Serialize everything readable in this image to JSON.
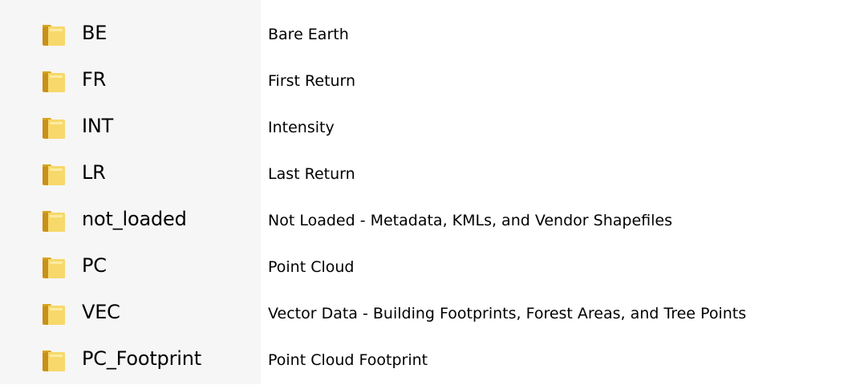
{
  "folders": [
    {
      "name": "BE",
      "description": "Bare Earth",
      "icon": "folder-icon"
    },
    {
      "name": "FR",
      "description": "First Return",
      "icon": "folder-icon"
    },
    {
      "name": "INT",
      "description": "Intensity",
      "icon": "folder-icon"
    },
    {
      "name": "LR",
      "description": "Last Return",
      "icon": "folder-icon"
    },
    {
      "name": "not_loaded",
      "description": "Not Loaded - Metadata, KMLs, and Vendor Shapefiles",
      "icon": "folder-icon"
    },
    {
      "name": "PC",
      "description": "Point Cloud",
      "icon": "folder-icon"
    },
    {
      "name": "VEC",
      "description": "Vector Data - Building Footprints, Forest Areas, and Tree Points",
      "icon": "folder-icon"
    },
    {
      "name": "PC_Footprint",
      "description": "Point Cloud Footprint",
      "icon": "folder-icon"
    }
  ],
  "colors": {
    "folder_back": "#d9a520",
    "folder_front": "#f7d86a",
    "folder_highlight": "#fff3b8",
    "panel_background": "#f6f6f6"
  }
}
